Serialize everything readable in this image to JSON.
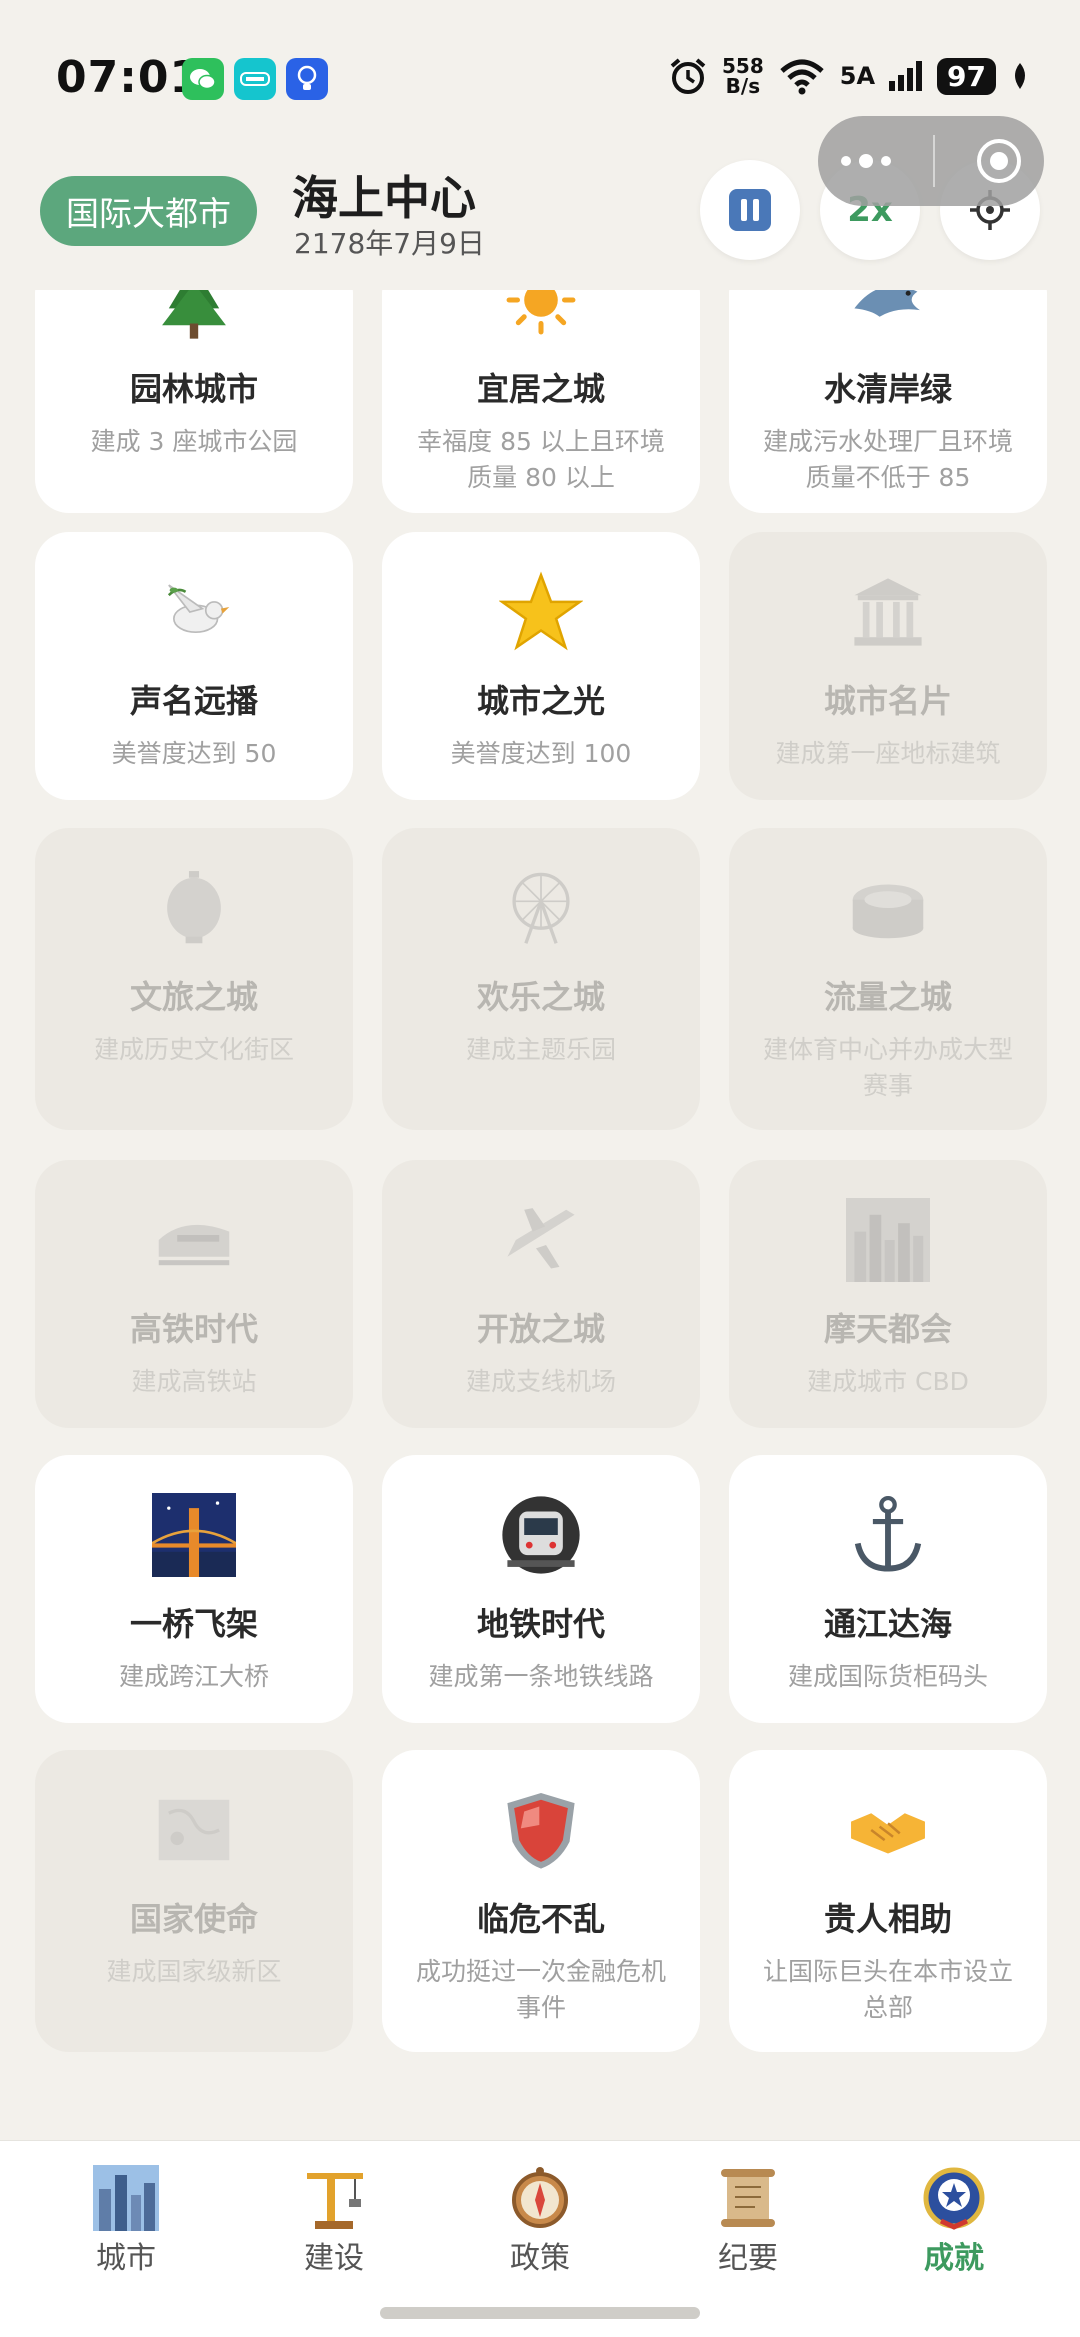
{
  "status_bar": {
    "time": "07:01",
    "net_speed_value": "558",
    "net_speed_unit": "B/s",
    "signal_label": "5A",
    "battery": "97"
  },
  "header": {
    "level": "国际大都市",
    "city_name": "海上中心",
    "date": "2178年7月9日",
    "speed_label": "2x"
  },
  "achievements": [
    {
      "title": "园林城市",
      "desc": "建成 3 座城市公园",
      "unlocked": true,
      "icon": "tree-icon"
    },
    {
      "title": "宜居之城",
      "desc": "幸福度 85 以上且环境质量 80 以上",
      "unlocked": true,
      "icon": "sun-icon"
    },
    {
      "title": "水清岸绿",
      "desc": "建成污水处理厂且环境质量不低于 85",
      "unlocked": true,
      "icon": "dolphin-icon"
    },
    {
      "title": "声名远播",
      "desc": "美誉度达到 50",
      "unlocked": true,
      "icon": "dove-icon"
    },
    {
      "title": "城市之光",
      "desc": "美誉度达到 100",
      "unlocked": true,
      "icon": "star-icon"
    },
    {
      "title": "城市名片",
      "desc": "建成第一座地标建筑",
      "unlocked": false,
      "icon": "classical-building-icon"
    },
    {
      "title": "文旅之城",
      "desc": "建成历史文化街区",
      "unlocked": false,
      "icon": "lantern-icon"
    },
    {
      "title": "欢乐之城",
      "desc": "建成主题乐园",
      "unlocked": false,
      "icon": "ferris-wheel-icon"
    },
    {
      "title": "流量之城",
      "desc": "建体育中心并办成大型赛事",
      "unlocked": false,
      "icon": "stadium-icon"
    },
    {
      "title": "高铁时代",
      "desc": "建成高铁站",
      "unlocked": false,
      "icon": "bullet-train-icon"
    },
    {
      "title": "开放之城",
      "desc": "建成支线机场",
      "unlocked": false,
      "icon": "airplane-icon"
    },
    {
      "title": "摩天都会",
      "desc": "建成城市 CBD",
      "unlocked": false,
      "icon": "skyline-icon"
    },
    {
      "title": "一桥飞架",
      "desc": "建成跨江大桥",
      "unlocked": true,
      "icon": "bridge-at-night-icon"
    },
    {
      "title": "地铁时代",
      "desc": "建成第一条地铁线路",
      "unlocked": true,
      "icon": "metro-icon"
    },
    {
      "title": "通江达海",
      "desc": "建成国际货柜码头",
      "unlocked": true,
      "icon": "anchor-icon"
    },
    {
      "title": "国家使命",
      "desc": "建成国家级新区",
      "unlocked": false,
      "icon": "world-map-icon"
    },
    {
      "title": "临危不乱",
      "desc": "成功挺过一次金融危机事件",
      "unlocked": true,
      "icon": "shield-icon"
    },
    {
      "title": "贵人相助",
      "desc": "让国际巨头在本市设立总部",
      "unlocked": true,
      "icon": "handshake-icon"
    }
  ],
  "nav": [
    {
      "label": "城市",
      "icon": "city-skyline-icon",
      "active": false
    },
    {
      "label": "建设",
      "icon": "construction-crane-icon",
      "active": false
    },
    {
      "label": "政策",
      "icon": "compass-icon",
      "active": false
    },
    {
      "label": "纪要",
      "icon": "scroll-icon",
      "active": false
    },
    {
      "label": "成就",
      "icon": "medal-badge-icon",
      "active": true
    }
  ],
  "colors": {
    "background": "#f3f1ec",
    "accent_green": "#5ca77d",
    "active_nav": "#3d9a5f",
    "card_unlocked": "#ffffff",
    "card_locked": "#ece9e3"
  }
}
